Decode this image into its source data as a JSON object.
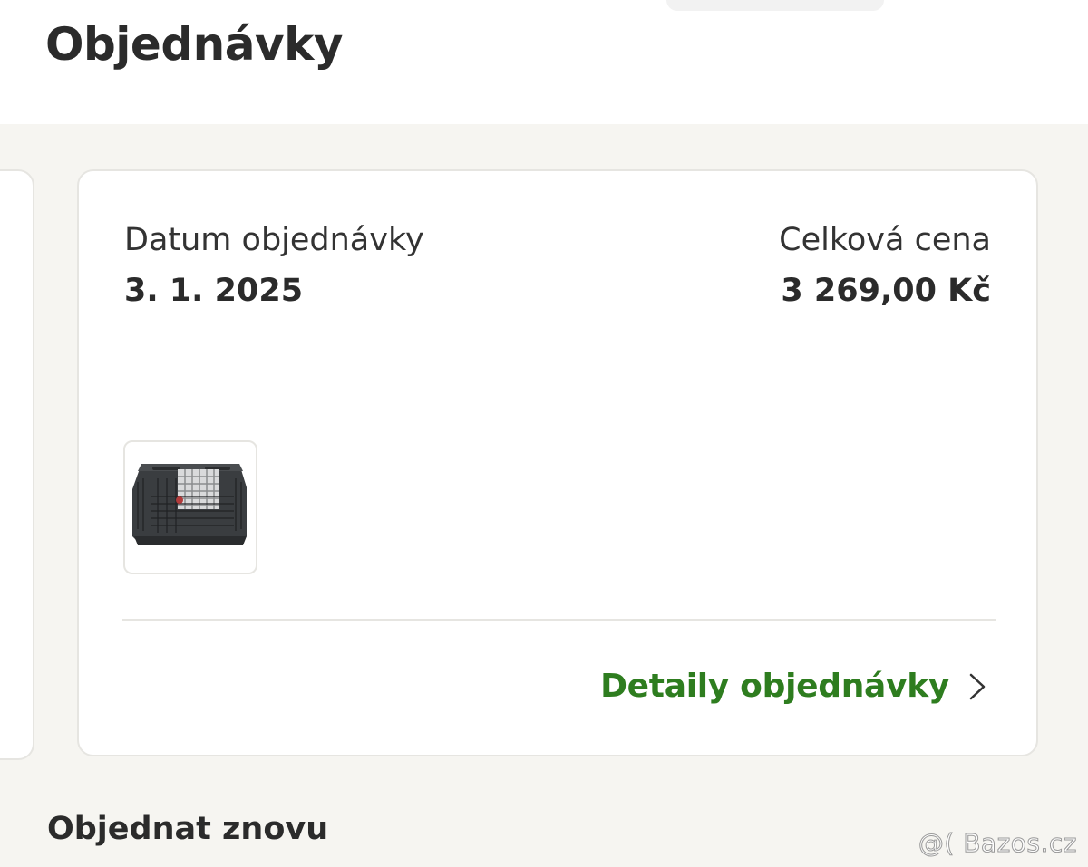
{
  "page": {
    "title": "Objednávky"
  },
  "order": {
    "date_label": "Datum objednávky",
    "date_value": "3. 1. 2025",
    "price_label": "Celková cena",
    "price_value": "3 269,00 Kč",
    "product_image": "dog-carrier-crate",
    "detail_link": "Detaily objednávky",
    "detail_icon": "chevron-right-icon",
    "accent_color": "#2e7d1f"
  },
  "reorder": {
    "title": "Objednat znovu"
  },
  "watermark": "@( Bazos.cz"
}
